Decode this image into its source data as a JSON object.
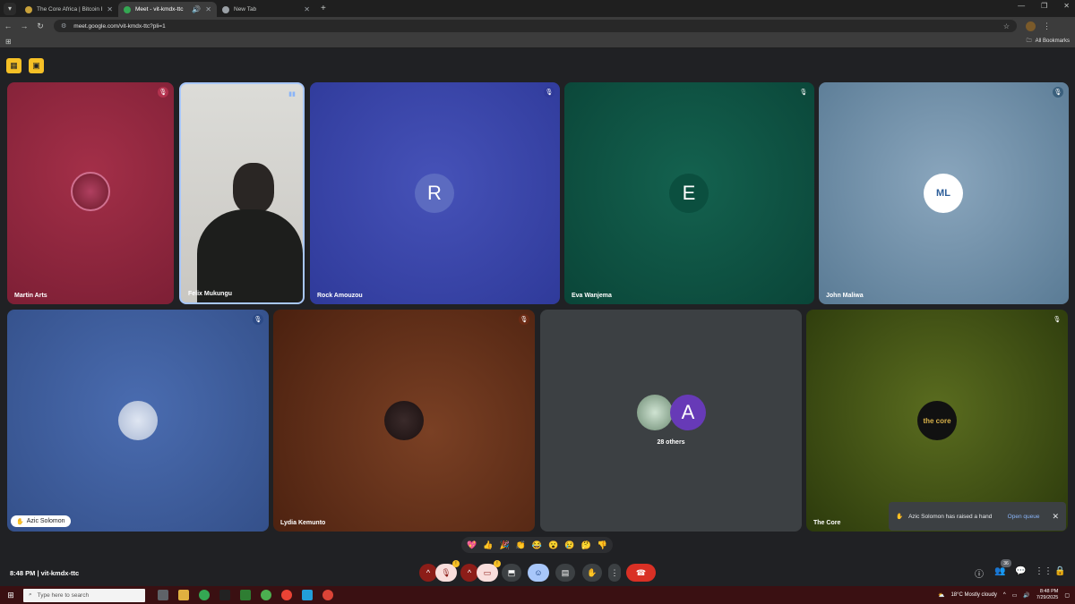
{
  "browser": {
    "tabs": [
      {
        "title": "The Core Africa | Bitcoin Educa",
        "active": false,
        "fav_color": "#c8a13a"
      },
      {
        "title": "Meet - vit-kmdx-ttc",
        "active": true,
        "fav_color": "#34a853"
      },
      {
        "title": "New Tab",
        "active": false,
        "fav_color": "#9aa0a6"
      }
    ],
    "url": "meet.google.com/vit-kmdx-ttc?pli=1",
    "bookmarks_label": "All Bookmarks"
  },
  "meet": {
    "meeting_time": "8:48 PM",
    "meeting_code": "vit-kmdx-ttc",
    "participants_count": "36",
    "others_label": "28 others",
    "tiles": [
      {
        "name": "Martin Arts",
        "bg": "#8b2540",
        "avatar": "",
        "mic": "muted"
      },
      {
        "name": "Felix Mukungu",
        "bg": "#cfd0cc",
        "avatar": "",
        "mic": "speaking"
      },
      {
        "name": "Rock Amouzou",
        "bg": "#3a44a8",
        "avatar": "R",
        "mic": "muted"
      },
      {
        "name": "Eva Wanjema",
        "bg": "#0d5446",
        "avatar": "E",
        "mic": "muted"
      },
      {
        "name": "John Maliwa",
        "bg": "#6e8fa9",
        "avatar": "ML",
        "mic": "muted"
      },
      {
        "name": "Azic Solomon",
        "bg": "#3c5d9a",
        "avatar": "",
        "mic": "muted"
      },
      {
        "name": "Lydia Kemunto",
        "bg": "#5e2a16",
        "avatar": "",
        "mic": "muted"
      },
      {
        "name": "The Core",
        "bg": "#3e4d14",
        "avatar": "the core",
        "mic": "muted"
      }
    ],
    "others_avatar": "A",
    "toast": {
      "text": "Azic Solomon has raised a hand",
      "action": "Open queue"
    },
    "reactions": [
      "💖",
      "👍",
      "🎉",
      "👏",
      "😂",
      "😮",
      "😢",
      "🤔",
      "👎"
    ]
  },
  "taskbar": {
    "search_placeholder": "Type here to search",
    "weather": "18°C  Mostly cloudy",
    "time": "8:48 PM",
    "date": "7/29/2025"
  }
}
